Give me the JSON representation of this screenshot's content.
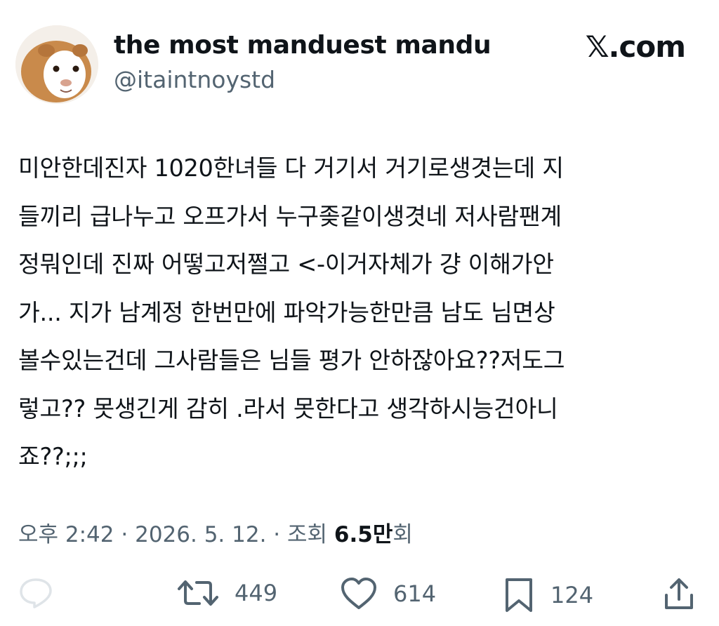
{
  "author": {
    "display_name": "the most manduest mandu",
    "handle": "@itaintnoystd",
    "avatar_icon": "guinea-pig-avatar"
  },
  "site": {
    "logo_text": "𝕏.com"
  },
  "tweet": {
    "lines": [
      "미안한데진자 1020한녀들 다 거기서 거기로생겻는데 지",
      "들끼리 급나누고 오프가서 누구좆같이생겻네 저사람팬계",
      "정뭐인데 진짜 어떻고저쩔고 <-이거자체가 걍 이해가안",
      "가... 지가 남계정 한번만에 파악가능한만큼 남도 님면상",
      "볼수있는건데 그사람들은 님들 평가 안하잖아요??저도그",
      "렇고?? 못생긴게 감히 .라서 못한다고 생각하시능건아니",
      "죠??;;;"
    ]
  },
  "meta": {
    "time": "오후 2:42",
    "separator": "·",
    "date": "2026. 5. 12.",
    "views_prefix": "조회",
    "views_count": "6.5만",
    "views_suffix": "회"
  },
  "actions": {
    "reply_icon": "reply-icon",
    "retweet_count": "449",
    "like_count": "614",
    "bookmark_count": "124",
    "share_icon": "share-icon"
  }
}
